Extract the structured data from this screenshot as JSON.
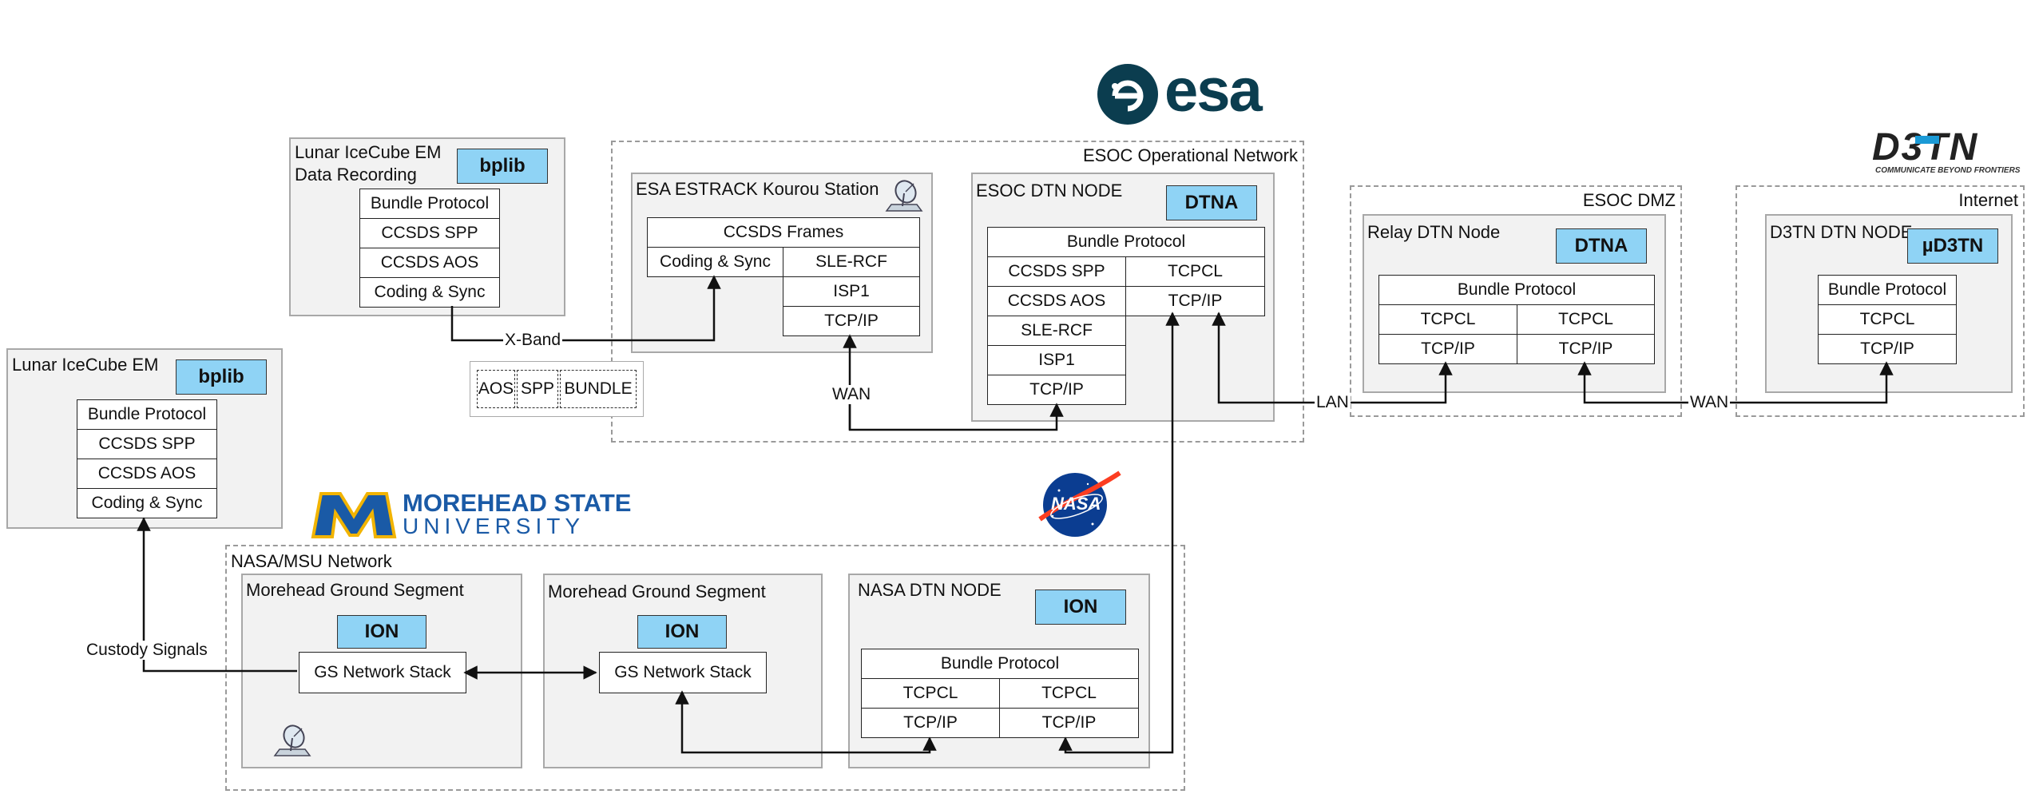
{
  "logos": {
    "esa": "esa",
    "d3tn": "D3TN",
    "d3tn_tagline": "COMMUNICATE BEYOND FRONTIERS",
    "msu_line1": "MOREHEAD STATE",
    "msu_line2": "UNIVERSITY",
    "nasa": "NASA"
  },
  "networks": {
    "esoc": "ESOC Operational Network",
    "dmz": "ESOC DMZ",
    "internet": "Internet",
    "nasa_msu": "NASA/MSU Network"
  },
  "nodes": {
    "lunar_em_rec": {
      "title_line1": "Lunar IceCube EM",
      "title_line2": "Data Recording",
      "badge": "bplib",
      "stack": [
        "Bundle Protocol",
        "CCSDS SPP",
        "CCSDS AOS",
        "Coding & Sync"
      ]
    },
    "lunar_em": {
      "title": "Lunar IceCube EM",
      "badge": "bplib",
      "stack": [
        "Bundle Protocol",
        "CCSDS SPP",
        "CCSDS AOS",
        "Coding & Sync"
      ]
    },
    "kourou": {
      "title": "ESA ESTRACK Kourou Station",
      "frames": "CCSDS Frames",
      "coding": "Coding & Sync",
      "right_stack": [
        "SLE-RCF",
        "ISP1",
        "TCP/IP"
      ]
    },
    "esoc_dtn": {
      "title": "ESOC DTN NODE",
      "badge": "DTNA",
      "top": "Bundle Protocol",
      "left_stack": [
        "CCSDS SPP",
        "CCSDS AOS",
        "SLE-RCF",
        "ISP1",
        "TCP/IP"
      ],
      "right_stack": [
        "TCPCL",
        "TCP/IP"
      ]
    },
    "relay": {
      "title": "Relay DTN Node",
      "badge": "DTNA",
      "top": "Bundle Protocol",
      "left": [
        "TCPCL",
        "TCP/IP"
      ],
      "right": [
        "TCPCL",
        "TCP/IP"
      ]
    },
    "d3tn_node": {
      "title": "D3TN DTN NODE",
      "badge": "µD3TN",
      "stack": [
        "Bundle Protocol",
        "TCPCL",
        "TCP/IP"
      ]
    },
    "msu_gs1": {
      "title": "Morehead Ground Segment",
      "badge": "ION",
      "stack": "GS Network Stack"
    },
    "msu_gs2": {
      "title": "Morehead Ground Segment",
      "badge": "ION",
      "stack": "GS Network Stack"
    },
    "nasa_dtn": {
      "title": "NASA DTN NODE",
      "badge": "ION",
      "top": "Bundle Protocol",
      "left": [
        "TCPCL",
        "TCP/IP"
      ],
      "right": [
        "TCPCL",
        "TCP/IP"
      ]
    }
  },
  "legend": [
    "AOS",
    "SPP",
    "BUNDLE"
  ],
  "links": {
    "xband": "X-Band",
    "wan1": "WAN",
    "lan": "LAN",
    "wan2": "WAN",
    "custody": "Custody Signals"
  },
  "colors": {
    "badge": "#8fd3f5",
    "node_bg": "#f2f2f2",
    "esa_logo": "#0b3d4f",
    "d3tn_blue": "#1a9ad6",
    "msu_blue": "#1a5aa6",
    "msu_gold": "#f2b400",
    "nasa_blue": "#0b3d91",
    "nasa_red": "#fc3d21"
  }
}
